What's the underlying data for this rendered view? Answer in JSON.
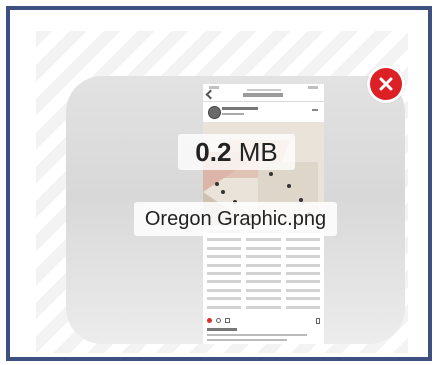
{
  "file": {
    "size_value": "0.2",
    "size_unit": "MB",
    "name": "Oregon Graphic.png"
  },
  "icons": {
    "remove": "close-circle-icon",
    "thumbnail": "image-thumbnail"
  },
  "colors": {
    "frame_border": "#3e5080",
    "remove_button": "#dd1f26"
  }
}
